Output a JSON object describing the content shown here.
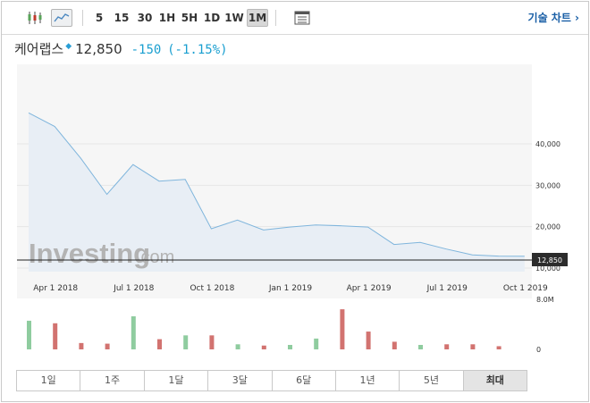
{
  "toolbar": {
    "periods": [
      "5",
      "15",
      "30",
      "1H",
      "5H",
      "1D",
      "1W",
      "1M"
    ],
    "active_period": "1M",
    "tech_chart_label": "기술 차트 ›"
  },
  "quote": {
    "name": "케어랩스",
    "price": "12,850",
    "change": "-150",
    "change_pct": "(-1.15%)"
  },
  "watermark": {
    "brand": "Investing",
    "suffix": ".com"
  },
  "chart_data": {
    "type": "area",
    "x": [
      "2018-03",
      "2018-04",
      "2018-05",
      "2018-06",
      "2018-07",
      "2018-08",
      "2018-09",
      "2018-10",
      "2018-11",
      "2018-12",
      "2019-01",
      "2019-02",
      "2019-03",
      "2019-04",
      "2019-05",
      "2019-06",
      "2019-07",
      "2019-08",
      "2019-09",
      "2019-10"
    ],
    "values": [
      47500,
      44200,
      36500,
      27800,
      35000,
      31000,
      31400,
      19500,
      21600,
      19200,
      19900,
      20400,
      20200,
      19900,
      15700,
      16200,
      14600,
      13200,
      12900,
      12850
    ],
    "last_price_label": "12,850",
    "x_ticks": [
      "Apr 1 2018",
      "Jul 1 2018",
      "Oct 1 2018",
      "Jan 1 2019",
      "Apr 1 2019",
      "Jul 1 2019",
      "Oct 1 2019"
    ],
    "y_ticks": [
      "40,000",
      "30,000",
      "20,000",
      "10,000"
    ],
    "y_tick_values": [
      40000,
      30000,
      20000,
      10000
    ],
    "volume": {
      "values": [
        4.5,
        4.1,
        1.0,
        0.9,
        5.2,
        1.6,
        2.2,
        2.2,
        0.8,
        0.6,
        0.7,
        1.7,
        6.3,
        2.8,
        1.2,
        0.7,
        0.8,
        0.8,
        0.5
      ],
      "directions": [
        "up",
        "down",
        "down",
        "down",
        "up",
        "down",
        "up",
        "down",
        "up",
        "down",
        "up",
        "up",
        "down",
        "down",
        "down",
        "up",
        "down",
        "down",
        "down"
      ],
      "y_ticks": [
        "8.0M",
        "0"
      ]
    },
    "colors": {
      "line": "#7fb5dc",
      "fill": "#e8eef5",
      "up": "#8fcc9f",
      "down": "#d27370"
    }
  },
  "range_buttons": [
    "1일",
    "1주",
    "1달",
    "3달",
    "6달",
    "1년",
    "5년",
    "최대"
  ],
  "active_range": "최대"
}
